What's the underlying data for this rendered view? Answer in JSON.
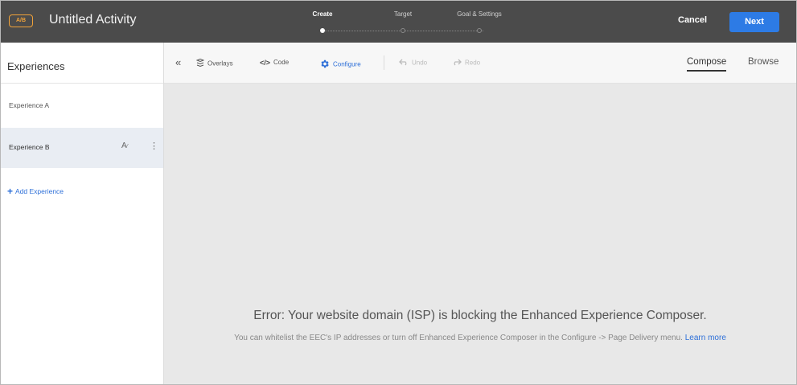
{
  "header": {
    "badge": "A/B",
    "activity_title": "Untitled Activity",
    "steps": [
      {
        "label": "Create",
        "active": true
      },
      {
        "label": "Target",
        "active": false
      },
      {
        "label": "Goal & Settings",
        "active": false
      }
    ],
    "cancel_label": "Cancel",
    "next_label": "Next"
  },
  "sidebar": {
    "title": "Experiences",
    "items": [
      {
        "label": "Experience A",
        "selected": false
      },
      {
        "label": "Experience B",
        "selected": true
      }
    ],
    "add_label": "Add Experience"
  },
  "toolbar": {
    "collapse_icon": "double-chevron-left-icon",
    "overlays_label": "Overlays",
    "code_label": "Code",
    "configure_label": "Configure",
    "undo_label": "Undo",
    "redo_label": "Redo",
    "compose_label": "Compose",
    "browse_label": "Browse"
  },
  "canvas": {
    "error_title": "Error: Your website domain (ISP) is blocking the Enhanced Experience Composer.",
    "error_body": "You can whitelist the EEC's IP addresses or turn off Enhanced Experience Composer in the Configure -> Page Delivery menu.",
    "learn_more": "Learn more"
  },
  "colors": {
    "header_bg": "#4b4b4b",
    "badge_orange": "#f0a239",
    "primary_blue": "#2d7be5",
    "link_blue": "#2d6fd8",
    "selected_row": "#e9edf3",
    "canvas_bg": "#e8e8e8"
  }
}
